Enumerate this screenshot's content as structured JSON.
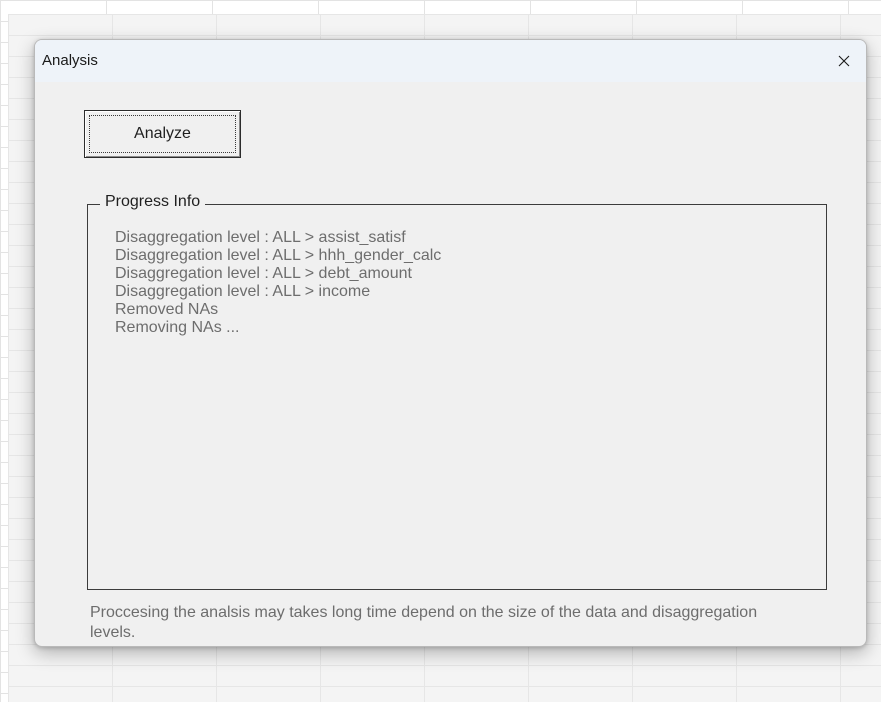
{
  "window": {
    "title": "Analysis",
    "close_glyph": "close-icon"
  },
  "actions": {
    "analyze_label": "Analyze"
  },
  "progress": {
    "legend": "Progress Info",
    "lines": [
      "Disaggregation level : ALL > assist_satisf",
      "Disaggregation level : ALL > hhh_gender_calc",
      "Disaggregation level : ALL > debt_amount",
      "Disaggregation level : ALL > income",
      "Removed NAs",
      "Removing NAs ..."
    ]
  },
  "footer": {
    "note": "Proccesing the analsis may takes long time depend on the size of the data and disaggregation levels."
  },
  "colors": {
    "title_bar": "#eef3f9",
    "dialog_bg": "#f0f0f0",
    "log_text": "#6d6d6d"
  }
}
